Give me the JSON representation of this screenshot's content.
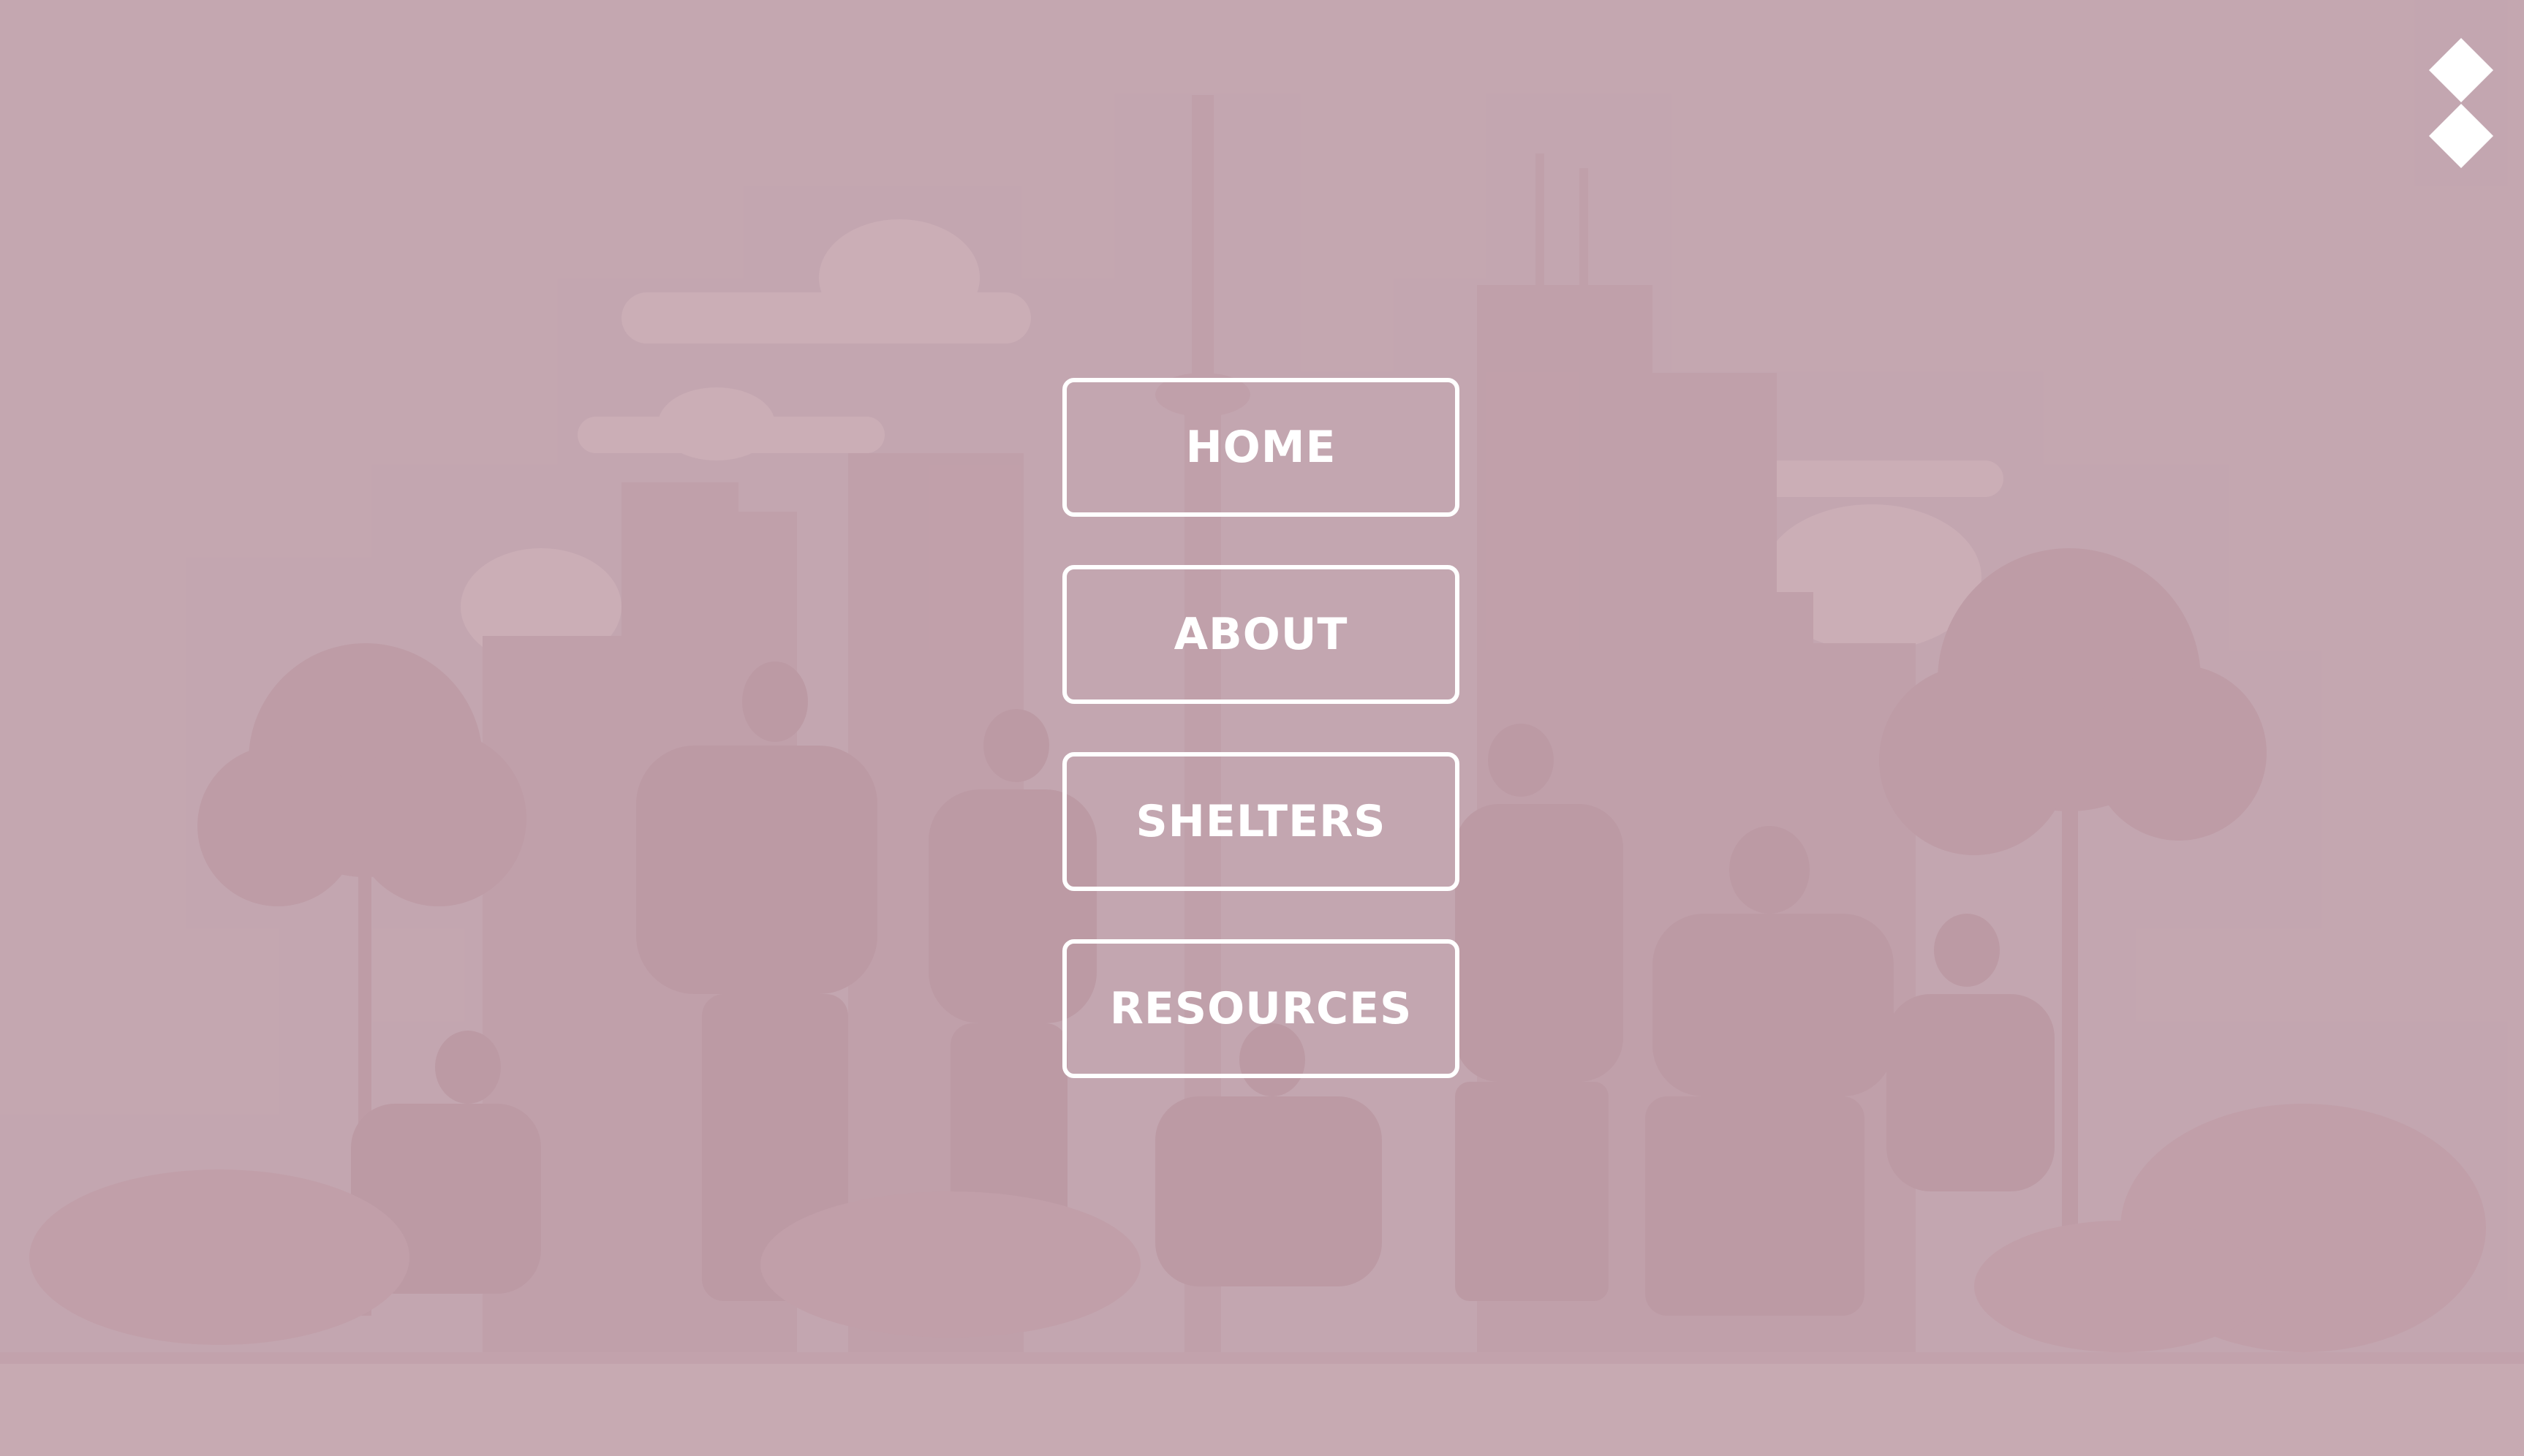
{
  "menu": {
    "items": [
      {
        "label": "HOME"
      },
      {
        "label": "ABOUT"
      },
      {
        "label": "SHELTERS"
      },
      {
        "label": "RESOURCES"
      }
    ]
  },
  "close": {
    "icon": "close-icon"
  },
  "colors": {
    "background": "#c4a7b0",
    "foreground": "#ffffff",
    "illustration_dark": "#b8949f",
    "illustration_light": "#ceb2ba"
  }
}
